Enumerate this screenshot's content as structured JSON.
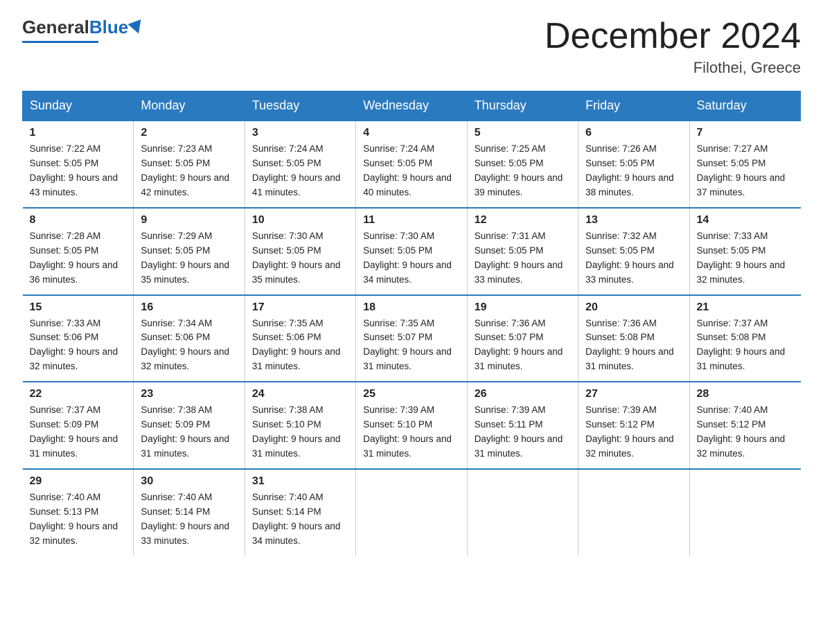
{
  "header": {
    "logo_general": "General",
    "logo_blue": "Blue",
    "month_title": "December 2024",
    "location": "Filothei, Greece"
  },
  "weekdays": [
    "Sunday",
    "Monday",
    "Tuesday",
    "Wednesday",
    "Thursday",
    "Friday",
    "Saturday"
  ],
  "weeks": [
    [
      {
        "day": "1",
        "sunrise": "7:22 AM",
        "sunset": "5:05 PM",
        "daylight": "9 hours and 43 minutes."
      },
      {
        "day": "2",
        "sunrise": "7:23 AM",
        "sunset": "5:05 PM",
        "daylight": "9 hours and 42 minutes."
      },
      {
        "day": "3",
        "sunrise": "7:24 AM",
        "sunset": "5:05 PM",
        "daylight": "9 hours and 41 minutes."
      },
      {
        "day": "4",
        "sunrise": "7:24 AM",
        "sunset": "5:05 PM",
        "daylight": "9 hours and 40 minutes."
      },
      {
        "day": "5",
        "sunrise": "7:25 AM",
        "sunset": "5:05 PM",
        "daylight": "9 hours and 39 minutes."
      },
      {
        "day": "6",
        "sunrise": "7:26 AM",
        "sunset": "5:05 PM",
        "daylight": "9 hours and 38 minutes."
      },
      {
        "day": "7",
        "sunrise": "7:27 AM",
        "sunset": "5:05 PM",
        "daylight": "9 hours and 37 minutes."
      }
    ],
    [
      {
        "day": "8",
        "sunrise": "7:28 AM",
        "sunset": "5:05 PM",
        "daylight": "9 hours and 36 minutes."
      },
      {
        "day": "9",
        "sunrise": "7:29 AM",
        "sunset": "5:05 PM",
        "daylight": "9 hours and 35 minutes."
      },
      {
        "day": "10",
        "sunrise": "7:30 AM",
        "sunset": "5:05 PM",
        "daylight": "9 hours and 35 minutes."
      },
      {
        "day": "11",
        "sunrise": "7:30 AM",
        "sunset": "5:05 PM",
        "daylight": "9 hours and 34 minutes."
      },
      {
        "day": "12",
        "sunrise": "7:31 AM",
        "sunset": "5:05 PM",
        "daylight": "9 hours and 33 minutes."
      },
      {
        "day": "13",
        "sunrise": "7:32 AM",
        "sunset": "5:05 PM",
        "daylight": "9 hours and 33 minutes."
      },
      {
        "day": "14",
        "sunrise": "7:33 AM",
        "sunset": "5:05 PM",
        "daylight": "9 hours and 32 minutes."
      }
    ],
    [
      {
        "day": "15",
        "sunrise": "7:33 AM",
        "sunset": "5:06 PM",
        "daylight": "9 hours and 32 minutes."
      },
      {
        "day": "16",
        "sunrise": "7:34 AM",
        "sunset": "5:06 PM",
        "daylight": "9 hours and 32 minutes."
      },
      {
        "day": "17",
        "sunrise": "7:35 AM",
        "sunset": "5:06 PM",
        "daylight": "9 hours and 31 minutes."
      },
      {
        "day": "18",
        "sunrise": "7:35 AM",
        "sunset": "5:07 PM",
        "daylight": "9 hours and 31 minutes."
      },
      {
        "day": "19",
        "sunrise": "7:36 AM",
        "sunset": "5:07 PM",
        "daylight": "9 hours and 31 minutes."
      },
      {
        "day": "20",
        "sunrise": "7:36 AM",
        "sunset": "5:08 PM",
        "daylight": "9 hours and 31 minutes."
      },
      {
        "day": "21",
        "sunrise": "7:37 AM",
        "sunset": "5:08 PM",
        "daylight": "9 hours and 31 minutes."
      }
    ],
    [
      {
        "day": "22",
        "sunrise": "7:37 AM",
        "sunset": "5:09 PM",
        "daylight": "9 hours and 31 minutes."
      },
      {
        "day": "23",
        "sunrise": "7:38 AM",
        "sunset": "5:09 PM",
        "daylight": "9 hours and 31 minutes."
      },
      {
        "day": "24",
        "sunrise": "7:38 AM",
        "sunset": "5:10 PM",
        "daylight": "9 hours and 31 minutes."
      },
      {
        "day": "25",
        "sunrise": "7:39 AM",
        "sunset": "5:10 PM",
        "daylight": "9 hours and 31 minutes."
      },
      {
        "day": "26",
        "sunrise": "7:39 AM",
        "sunset": "5:11 PM",
        "daylight": "9 hours and 31 minutes."
      },
      {
        "day": "27",
        "sunrise": "7:39 AM",
        "sunset": "5:12 PM",
        "daylight": "9 hours and 32 minutes."
      },
      {
        "day": "28",
        "sunrise": "7:40 AM",
        "sunset": "5:12 PM",
        "daylight": "9 hours and 32 minutes."
      }
    ],
    [
      {
        "day": "29",
        "sunrise": "7:40 AM",
        "sunset": "5:13 PM",
        "daylight": "9 hours and 32 minutes."
      },
      {
        "day": "30",
        "sunrise": "7:40 AM",
        "sunset": "5:14 PM",
        "daylight": "9 hours and 33 minutes."
      },
      {
        "day": "31",
        "sunrise": "7:40 AM",
        "sunset": "5:14 PM",
        "daylight": "9 hours and 34 minutes."
      },
      null,
      null,
      null,
      null
    ]
  ]
}
